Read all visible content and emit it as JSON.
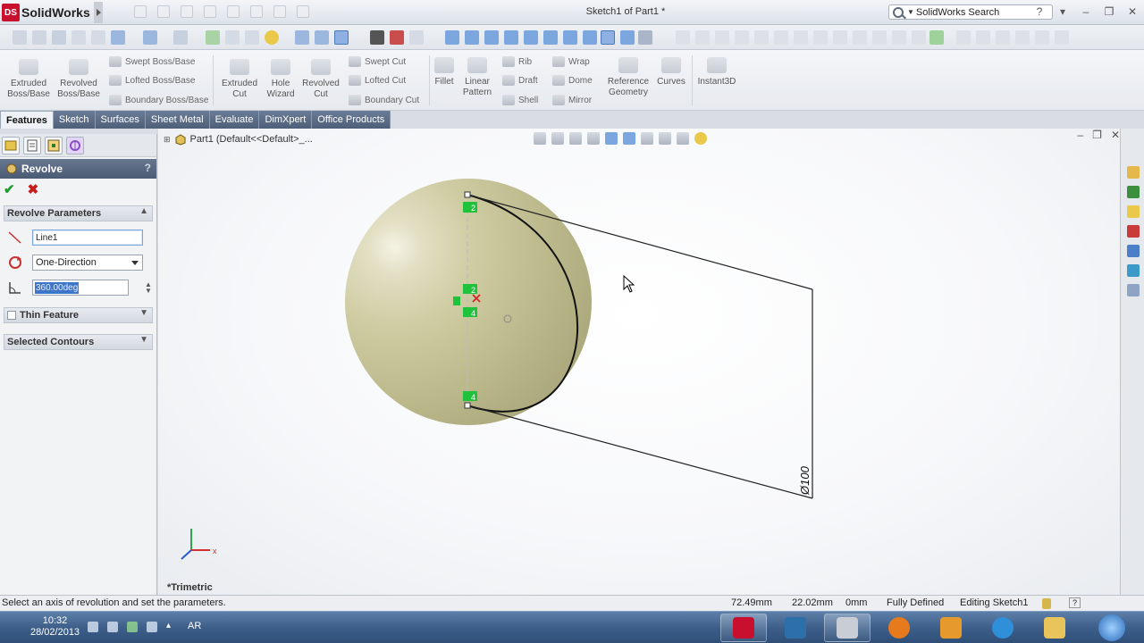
{
  "app": {
    "name": "SolidWorks",
    "logo_letters": "DS",
    "document_title": "Sketch1 of Part1 *",
    "search_placeholder": "SolidWorks Search"
  },
  "command_manager": {
    "big_buttons": [
      {
        "label": "Extruded\nBoss/Base"
      },
      {
        "label": "Revolved\nBoss/Base"
      },
      {
        "label": "Extruded\nCut"
      },
      {
        "label": "Hole\nWizard"
      },
      {
        "label": "Revolved\nCut"
      },
      {
        "label": "Fillet"
      },
      {
        "label": "Linear\nPattern"
      },
      {
        "label": "Reference\nGeometry"
      },
      {
        "label": "Curves"
      },
      {
        "label": "Instant3D"
      }
    ],
    "small_buttons": [
      {
        "label": "Swept Boss/Base"
      },
      {
        "label": "Lofted Boss/Base"
      },
      {
        "label": "Boundary Boss/Base"
      },
      {
        "label": "Swept Cut"
      },
      {
        "label": "Lofted Cut"
      },
      {
        "label": "Boundary Cut"
      },
      {
        "label": "Rib"
      },
      {
        "label": "Draft"
      },
      {
        "label": "Shell"
      },
      {
        "label": "Wrap"
      },
      {
        "label": "Dome"
      },
      {
        "label": "Mirror"
      }
    ]
  },
  "tabs": [
    {
      "label": "Features",
      "active": true
    },
    {
      "label": "Sketch"
    },
    {
      "label": "Surfaces"
    },
    {
      "label": "Sheet Metal"
    },
    {
      "label": "Evaluate"
    },
    {
      "label": "DimXpert"
    },
    {
      "label": "Office Products"
    }
  ],
  "property_manager": {
    "title": "Revolve",
    "help": "?",
    "ok_glyph": "✔",
    "cancel_glyph": "✖",
    "revolve_parameters": {
      "header": "Revolve Parameters",
      "axis_value": "Line1",
      "direction_value": "One-Direction",
      "angle_value": "360.00deg"
    },
    "thin_feature": {
      "header": "Thin Feature"
    },
    "selected_contours": {
      "header": "Selected Contours"
    }
  },
  "viewport": {
    "tree_item": "Part1  (Default<<Default>_...",
    "view_label": "*Trimetric",
    "dimension_text": "Ø100",
    "relation_labels": [
      "2",
      "2",
      "4",
      "4"
    ],
    "triad_x": "x"
  },
  "status_bar": {
    "message": "Select an axis of revolution and set the parameters.",
    "x_coord": "72.49mm",
    "y_coord": "22.02mm",
    "z_coord": "0mm",
    "sketch_state": "Fully Defined",
    "editing": "Editing Sketch1",
    "help_glyph": "?"
  },
  "taskbar": {
    "time": "10:32",
    "date": "28/02/2013",
    "lang": "AR"
  },
  "colors": {
    "sphere": "#c9c69e",
    "relation_green": "#1fc33b",
    "accent_blue": "#3d75c9",
    "sw_red": "#c8102e"
  }
}
